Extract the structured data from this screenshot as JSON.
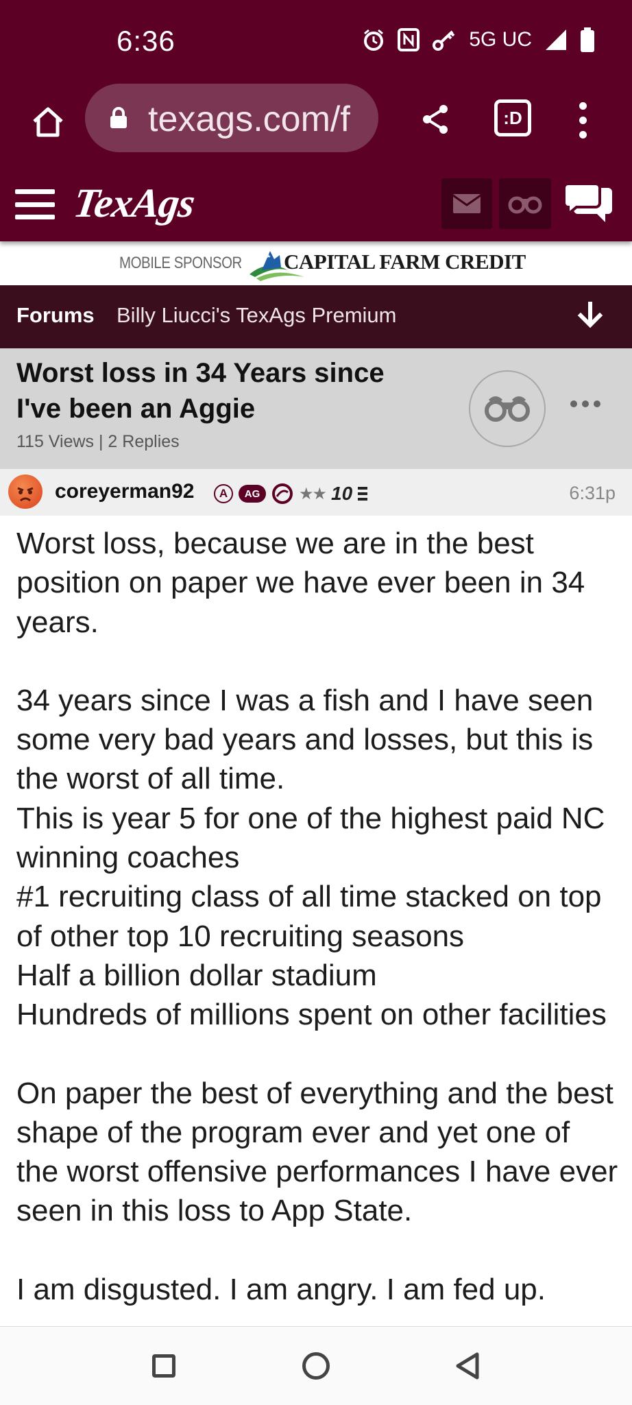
{
  "status_bar": {
    "time": "6:36",
    "network": "5G UC",
    "icons": [
      "alarm-icon",
      "nfc-icon",
      "key-icon",
      "signal-icon",
      "battery-icon"
    ]
  },
  "browser": {
    "url": "texags.com/f",
    "tab_label": ":D",
    "icons": [
      "home-icon",
      "lock-icon",
      "share-icon",
      "tabs-icon",
      "overflow-menu-icon"
    ]
  },
  "site_header": {
    "logo": "TexAgs",
    "icons": [
      "hamburger-icon",
      "mail-icon",
      "binoculars-icon",
      "chat-icon"
    ]
  },
  "sponsor": {
    "label": "MOBILE SPONSOR",
    "name": "CAPITAL FARM CREDIT"
  },
  "breadcrumb": {
    "forums": "Forums",
    "board": "Billy Liucci's TexAgs Premium"
  },
  "thread": {
    "title": "Worst loss in 34 Years since I've been an Aggie",
    "meta": "115 Views | 2 Replies"
  },
  "post": {
    "username": "coreyerman92",
    "badge_a": "A",
    "badge_ag": "AG",
    "stars": "★★",
    "rank": "10",
    "time": "6:31p",
    "paragraphs": [
      "Worst loss, because we are in the best position on paper we have ever been in 34 years.",
      "34 years since I was a fish and I have seen some very bad years and losses, but this is the worst of all time.\nThis is year 5 for one of the highest paid NC winning coaches\n#1 recruiting class of all time stacked on top of other top 10 recruiting seasons\nHalf a billion dollar stadium\nHundreds of millions spent on other facilities",
      "On paper the best of everything and the best shape of the program ever and yet one of the worst offensive performances I have ever seen in this loss to App State.",
      "I am disgusted. I am angry. I am fed up."
    ]
  },
  "colors": {
    "brand_maroon": "#5c0025",
    "breadcrumb_bg": "#3a0e1d",
    "thread_header_bg": "#d4d4d4"
  }
}
